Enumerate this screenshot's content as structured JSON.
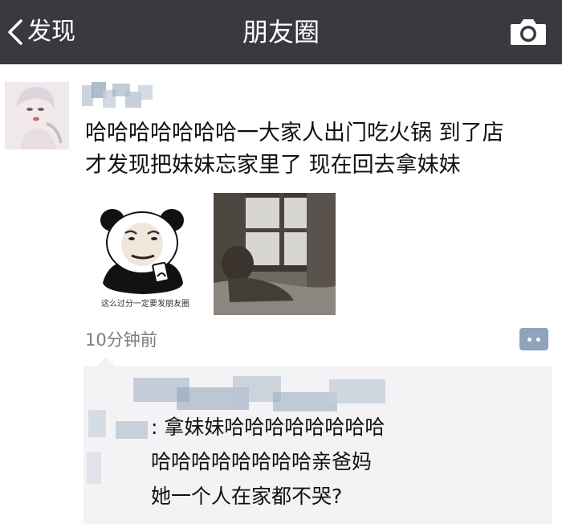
{
  "navbar": {
    "back_label": "发现",
    "title": "朋友圈",
    "back_icon": "chevron-left-icon",
    "camera_icon": "camera-icon",
    "background": "#393a3f"
  },
  "post": {
    "text": "哈哈哈哈哈哈哈一大家人出门吃火锅 到了店\n才发现把妹妹忘家里了 现在回去拿妹妹",
    "images": [
      {
        "caption": "这么过分一定要发朋友圈"
      },
      {
        "caption": ""
      }
    ],
    "timestamp": "10分钟前",
    "comment_icon": "comment-icon"
  },
  "comments": {
    "lines": [
      ": 拿妹妹哈哈哈哈哈哈哈哈",
      "哈哈哈哈哈哈哈哈亲爸妈",
      "她一个人在家都不哭?"
    ]
  }
}
